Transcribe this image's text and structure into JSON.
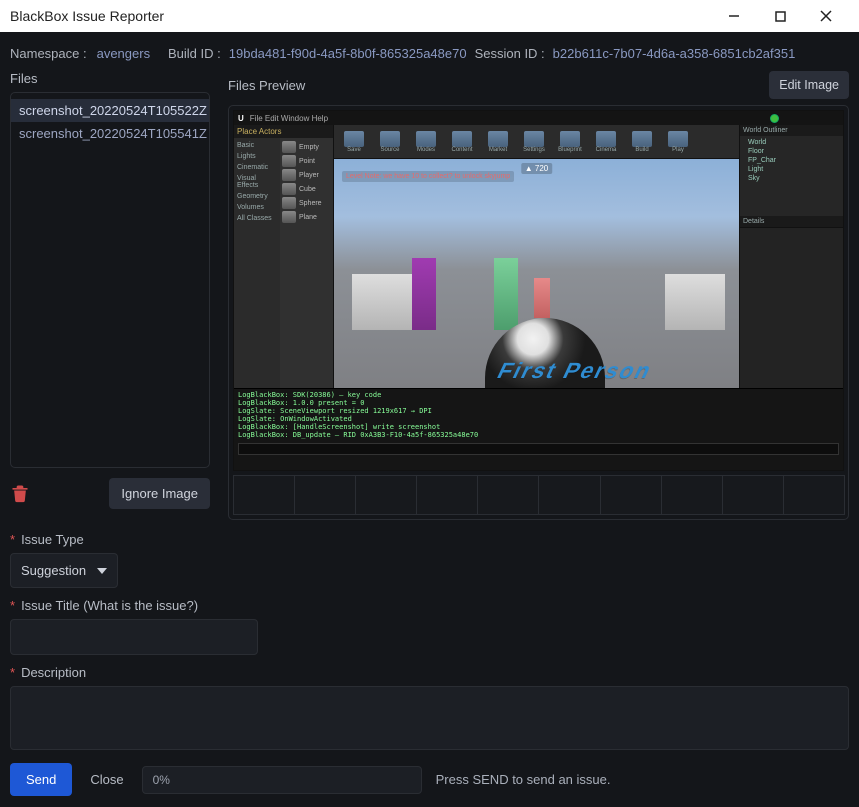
{
  "window": {
    "title": "BlackBox Issue Reporter"
  },
  "meta": {
    "namespace_label": "Namespace :",
    "namespace_value": "avengers",
    "build_label": "Build ID :",
    "build_value": "19bda481-f90d-4a5f-8b0f-865325a48e70",
    "session_label": "Session ID :",
    "session_value": "b22b611c-7b07-4d6a-a358-6851cb2af351"
  },
  "files": {
    "heading": "Files",
    "items": [
      {
        "name": "screenshot_20220524T105522Z",
        "selected": true
      },
      {
        "name": "screenshot_20220524T105541Z",
        "selected": false
      }
    ],
    "ignore_label": "Ignore Image"
  },
  "preview": {
    "heading": "Files Preview",
    "edit_label": "Edit Image",
    "ue": {
      "hud_warning": "Level Note: we have 10 to collect? to unlock skyjump",
      "fps": "▲ 720",
      "floor_text": "First Person",
      "left_header": "Place Actors",
      "categories": [
        "Basic",
        "Lights",
        "Cinematic",
        "Visual Effects",
        "Geometry",
        "Volumes",
        "All Classes"
      ],
      "things": [
        "Empty",
        "Point",
        "Player",
        "Cube",
        "Sphere",
        "Plane"
      ],
      "toolbar": [
        "Save",
        "Source",
        "Modes",
        "Content",
        "Market",
        "Settings",
        "Blueprint",
        "Cinema",
        "Build",
        "Play"
      ],
      "outliner_hdr": "World Outliner",
      "outliner": [
        "World",
        "  Floor",
        "  FP_Char",
        "  Light",
        "  Sky"
      ],
      "details_hdr": "Details",
      "log_lines": [
        "LogBlackBox: SDK(20386) — key code",
        "LogBlackBox: 1.0.0 present = 0",
        "LogSlate: SceneViewport resized 1219x617 → DPI",
        "LogSlate: OnWindowActivated",
        "LogBlackBox: [HandleScreenshot] write screenshot",
        "LogBlackBox: DB_update — RID 0xA3B3-F10-4a5f-865325a48e70"
      ]
    }
  },
  "form": {
    "type_label": "Issue Type",
    "type_value": "Suggestion",
    "title_label": "Issue Title (What is the issue?)",
    "title_value": "",
    "desc_label": "Description",
    "desc_value": ""
  },
  "footer": {
    "send": "Send",
    "close": "Close",
    "progress": "0%",
    "hint": "Press SEND to send an issue."
  }
}
